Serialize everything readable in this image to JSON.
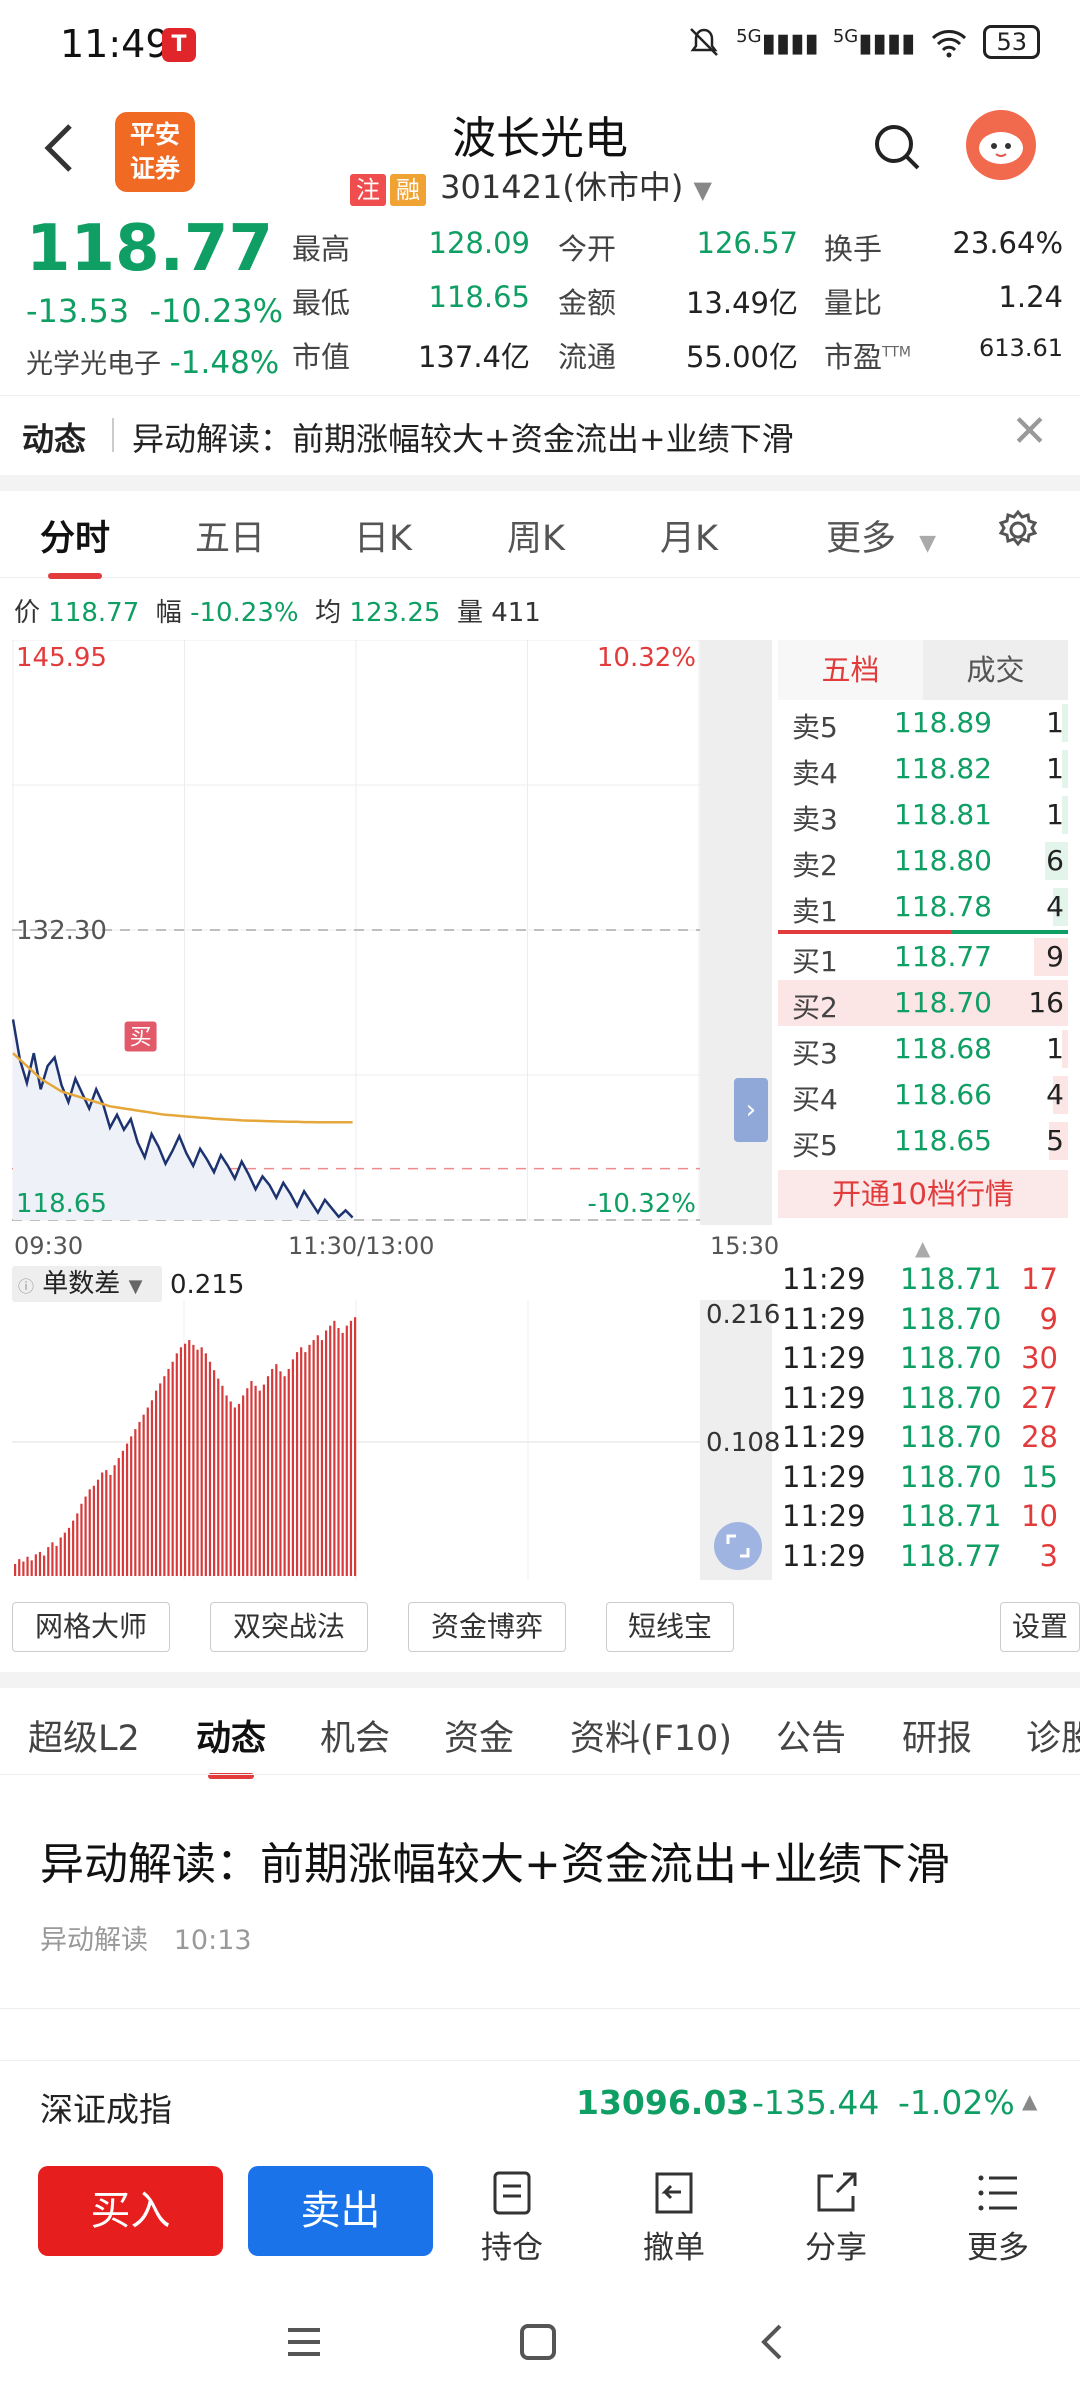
{
  "status": {
    "time": "11:49",
    "net1": "5G",
    "net2": "5G",
    "battery": "53"
  },
  "header": {
    "stock_name": "波长光电",
    "tag1": "注",
    "tag2": "融",
    "code": "301421",
    "market_state": "(休市中)",
    "logo_line1": "平安",
    "logo_line2": "证券"
  },
  "quote": {
    "price": "118.77",
    "change": "-13.53",
    "change_pct": "-10.23%",
    "industry": "光学光电子",
    "industry_pct": "-1.48%",
    "fields": [
      {
        "label": "最高",
        "value": "128.09"
      },
      {
        "label": "今开",
        "value": "126.57"
      },
      {
        "label": "换手",
        "value": "23.64%"
      },
      {
        "label": "最低",
        "value": "118.65"
      },
      {
        "label": "金额",
        "value": "13.49亿"
      },
      {
        "label": "量比",
        "value": "1.24"
      },
      {
        "label": "市值",
        "value": "137.4亿"
      },
      {
        "label": "流通",
        "value": "55.00亿"
      },
      {
        "label": "市盈",
        "value": "613.61",
        "sup": "TTM"
      }
    ]
  },
  "banner": {
    "title": "动态",
    "text": "异动解读：前期涨幅较大+资金流出+业绩下滑"
  },
  "chart_tabs": [
    "分时",
    "五日",
    "日K",
    "周K",
    "月K",
    "更多"
  ],
  "infoline": {
    "price_label": "价",
    "price": "118.77",
    "amp_label": "幅",
    "amp": "-10.23%",
    "avg_label": "均",
    "avg": "123.25",
    "vol_label": "量",
    "vol": "411"
  },
  "chart_data": {
    "type": "line",
    "y_max_label": "145.95",
    "y_mid_label": "132.30",
    "y_min_label": "118.65",
    "pct_max_label": "10.32%",
    "pct_min_label": "-10.32%",
    "x_labels": [
      "09:30",
      "11:30/13:00",
      "15:30"
    ],
    "ylim": [
      118.65,
      145.95
    ],
    "x_total_minutes": 240,
    "price_series": [
      128.09,
      126.2,
      125.1,
      126.5,
      124.8,
      125.9,
      126.3,
      125.0,
      124.2,
      125.3,
      124.6,
      123.9,
      124.8,
      124.1,
      123.0,
      123.6,
      122.9,
      123.4,
      122.3,
      121.6,
      122.7,
      122.1,
      121.3,
      121.9,
      122.6,
      121.8,
      121.2,
      122.0,
      121.5,
      120.9,
      121.7,
      121.2,
      120.6,
      121.4,
      120.8,
      120.1,
      120.7,
      120.3,
      119.7,
      120.4,
      119.9,
      119.3,
      120.0,
      119.5,
      119.0,
      119.6,
      119.2,
      118.8,
      119.1,
      118.77
    ],
    "avg_series": [
      126.5,
      126.2,
      125.9,
      125.6,
      125.3,
      125.1,
      124.9,
      124.7,
      124.6,
      124.5,
      124.4,
      124.3,
      124.2,
      124.1,
      124.0,
      123.95,
      123.9,
      123.85,
      123.8,
      123.75,
      123.7,
      123.65,
      123.6,
      123.58,
      123.55,
      123.52,
      123.5,
      123.47,
      123.45,
      123.42,
      123.4,
      123.38,
      123.36,
      123.34,
      123.33,
      123.32,
      123.31,
      123.3,
      123.29,
      123.28,
      123.27,
      123.27,
      123.26,
      123.26,
      123.25,
      123.25,
      123.25,
      123.25,
      123.25,
      123.25
    ],
    "buy_marker": "买"
  },
  "indicator": {
    "name": "单数差",
    "value": "0.215",
    "axis_top": "0.216",
    "axis_mid": "0.108",
    "bars": [
      0.01,
      0.014,
      0.012,
      0.016,
      0.013,
      0.018,
      0.02,
      0.017,
      0.024,
      0.028,
      0.025,
      0.032,
      0.036,
      0.04,
      0.046,
      0.052,
      0.06,
      0.066,
      0.072,
      0.075,
      0.08,
      0.086,
      0.088,
      0.084,
      0.092,
      0.098,
      0.104,
      0.11,
      0.116,
      0.122,
      0.128,
      0.134,
      0.14,
      0.146,
      0.154,
      0.16,
      0.166,
      0.172,
      0.178,
      0.185,
      0.19,
      0.193,
      0.196,
      0.192,
      0.188,
      0.19,
      0.185,
      0.178,
      0.171,
      0.164,
      0.158,
      0.15,
      0.145,
      0.14,
      0.143,
      0.15,
      0.156,
      0.162,
      0.158,
      0.154,
      0.159,
      0.166,
      0.172,
      0.176,
      0.17,
      0.166,
      0.172,
      0.18,
      0.186,
      0.19,
      0.186,
      0.192,
      0.196,
      0.2,
      0.196,
      0.204,
      0.208,
      0.212,
      0.206,
      0.202,
      0.208,
      0.212,
      0.215
    ]
  },
  "orderbook": {
    "tab1": "五档",
    "tab2": "成交",
    "sell": [
      {
        "label": "卖5",
        "price": "118.89",
        "qty": "1",
        "bar": 0.04
      },
      {
        "label": "卖4",
        "price": "118.82",
        "qty": "1",
        "bar": 0.04
      },
      {
        "label": "卖3",
        "price": "118.81",
        "qty": "1",
        "bar": 0.04
      },
      {
        "label": "卖2",
        "price": "118.80",
        "qty": "6",
        "bar": 0.38
      },
      {
        "label": "卖1",
        "price": "118.78",
        "qty": "4",
        "bar": 0.25
      }
    ],
    "buy": [
      {
        "label": "买1",
        "price": "118.77",
        "qty": "9",
        "bar": 0.56
      },
      {
        "label": "买2",
        "price": "118.70",
        "qty": "16",
        "bar": 1.0
      },
      {
        "label": "买3",
        "price": "118.68",
        "qty": "1",
        "bar": 0.06
      },
      {
        "label": "买4",
        "price": "118.66",
        "qty": "4",
        "bar": 0.25
      },
      {
        "label": "买5",
        "price": "118.65",
        "qty": "5",
        "bar": 0.31
      }
    ],
    "upgrade": "开通10档行情"
  },
  "trades": [
    {
      "time": "11:29",
      "price": "118.71",
      "qty": "17",
      "dir": "up"
    },
    {
      "time": "11:29",
      "price": "118.70",
      "qty": "9",
      "dir": "up"
    },
    {
      "time": "11:29",
      "price": "118.70",
      "qty": "30",
      "dir": "up"
    },
    {
      "time": "11:29",
      "price": "118.70",
      "qty": "27",
      "dir": "up"
    },
    {
      "time": "11:29",
      "price": "118.70",
      "qty": "28",
      "dir": "up"
    },
    {
      "time": "11:29",
      "price": "118.70",
      "qty": "15",
      "dir": "down"
    },
    {
      "time": "11:29",
      "price": "118.71",
      "qty": "10",
      "dir": "up"
    },
    {
      "time": "11:29",
      "price": "118.77",
      "qty": "3",
      "dir": "up"
    }
  ],
  "tools": [
    "网格大师",
    "双突战法",
    "资金博弈",
    "短线宝",
    "设置"
  ],
  "bottom_tabs": [
    "超级L2",
    "动态",
    "机会",
    "资金",
    "资料(F10)",
    "公告",
    "研报",
    "诊股"
  ],
  "article": {
    "title": "异动解读：前期涨幅较大+资金流出+业绩下滑",
    "source": "异动解读",
    "time": "10:13"
  },
  "index": {
    "name": "深证成指",
    "value": "13096.03",
    "change": "-135.44",
    "pct": "-1.02%"
  },
  "actions": {
    "buy": "买入",
    "sell": "卖出",
    "hold": "持仓",
    "cancel": "撤单",
    "share": "分享",
    "more": "更多"
  },
  "colors": {
    "up": "#e23b3b",
    "down": "#0f9e63",
    "price_line": "#1d3370",
    "avg_line": "#e6a73a",
    "buy_btn": "#e61e1e",
    "sell_btn": "#1a73e8"
  }
}
